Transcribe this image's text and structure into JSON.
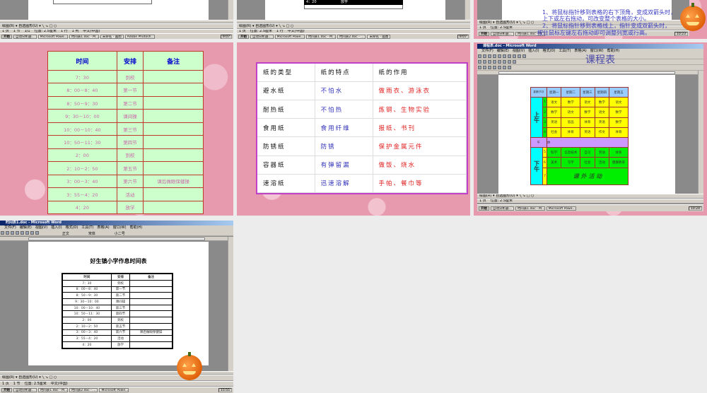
{
  "word_chrome": {
    "app_title_t6": "课程表.doc - Microsoft Word",
    "app_title_t7": "时间表1.doc - Microsoft Word",
    "menus": [
      "文件(F)",
      "编辑(E)",
      "视图(V)",
      "插入(I)",
      "格式(O)",
      "工具(T)",
      "表格(A)",
      "窗口(W)",
      "帮助(H)"
    ],
    "style_box": "正文",
    "font_box": "宋体",
    "size_box": "小二号",
    "draw_toolbar": "绘图(R) ▾  自选图形(U) ▾  ╲ ↘ □ ○",
    "status": [
      "1 页",
      "1 节",
      "1/1",
      "位置: 2.5厘米",
      "1 行",
      "1 列",
      "录制",
      "修订",
      "扩展",
      "改写",
      "中文(中国)"
    ],
    "start": "开始",
    "taskbar_items": [
      "自动分析器...",
      "Microsoft Powe...",
      "时间表1.doc - M...",
      "时间表2.doc - ...",
      "未命名 - 画图",
      "Adobe Photosh..."
    ],
    "clock_t1": "9:07",
    "clock_t2": "9:07",
    "clock_t3": "10:23",
    "clock_t6": "10:24",
    "clock_t7": "15:55"
  },
  "t2_selected_row": [
    "4：20",
    "放学"
  ],
  "t3_overlay": [
    "1、将鼠标指针移到表格的右下顶角，变成双箭头时，",
    "上下或左右拖动，可改变整个表格的大小。",
    "2、将鼠标指针移到表格线上，指针变成双箭头时，",
    "按住鼠标左键左右拖动即可调整列宽或行高。"
  ],
  "timetable": {
    "headers": [
      "时间",
      "安排",
      "备注"
    ],
    "rows": [
      [
        "7：30",
        "到校",
        ""
      ],
      [
        "8：00－8：40",
        "第一节",
        ""
      ],
      [
        "8：50－9：30",
        "第二节",
        ""
      ],
      [
        "9：30－10：00",
        "课间操",
        ""
      ],
      [
        "10：00－10：40",
        "第三节",
        ""
      ],
      [
        "10：50－11：30",
        "第四节",
        ""
      ],
      [
        "2：00",
        "到校",
        ""
      ],
      [
        "2：10－2：50",
        "第五节",
        ""
      ],
      [
        "3：00－3：40",
        "第六节",
        "课后做眼保健操"
      ],
      [
        "3：55－4：20",
        "活动",
        ""
      ],
      [
        "4：20",
        "放学",
        ""
      ]
    ]
  },
  "paper": {
    "headers": [
      "纸的类型",
      "纸的特点",
      "纸的作用"
    ],
    "rows": [
      [
        "避水纸",
        "不怕水",
        "做雨衣、游泳衣"
      ],
      [
        "耐热纸",
        "不怕热",
        "炼钢、生物实验"
      ],
      [
        "食用纸",
        "食用纤维",
        "报纸、书刊"
      ],
      [
        "防锈纸",
        "防锈",
        "保护金属元件"
      ],
      [
        "容器纸",
        "有弹留漏",
        "做饭、烧水"
      ],
      [
        "速溶纸",
        "迅速溶解",
        "手帕、餐巾等"
      ]
    ]
  },
  "schedule": {
    "title": "课程表",
    "corner": "星期\\节次",
    "days": [
      "星期一",
      "星期二",
      "星期三",
      "星期四",
      "星期五"
    ],
    "morning_label": "上午",
    "afternoon_label": "下午",
    "noon": [
      "午",
      "休"
    ],
    "morning": [
      [
        "1",
        "语文",
        "数学",
        "语文",
        "数学",
        "语文"
      ],
      [
        "2",
        "数学",
        "语文",
        "数学",
        "语文",
        "数学"
      ],
      [
        "3",
        "英语",
        "思品",
        "体育",
        "英语",
        "数学"
      ],
      [
        "4",
        "社会",
        "体育",
        "英语",
        "作文",
        "体育"
      ]
    ],
    "afternoon": [
      [
        "5",
        "科学",
        "信息技术",
        "自习",
        "劳动",
        "体育"
      ],
      [
        "6",
        "美术",
        "写字",
        "社会",
        "活动",
        "健康教育"
      ]
    ],
    "last_period": [
      "7",
      "课 外 活 动"
    ]
  },
  "t7_doc_title": "好生镇小学作息时间表",
  "colors": {
    "pink_bg": "#e79aae",
    "green_cell": "#ccffcc",
    "red_border": "#c0392b",
    "purple_border": "#c040c8",
    "yellow": "#ffff00",
    "green": "#00ee00",
    "cyan": "#00ffff",
    "lilac": "#cc99ff"
  }
}
